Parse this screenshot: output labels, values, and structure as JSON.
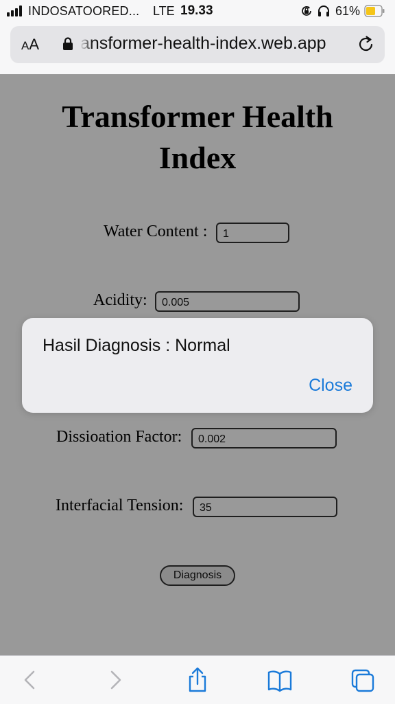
{
  "status_bar": {
    "carrier": "INDOSATOORED...",
    "network": "LTE",
    "time": "19.33",
    "battery_percent": "61%",
    "icons": [
      "signal-bars-icon",
      "orientation-lock-icon",
      "headphones-icon",
      "battery-icon"
    ]
  },
  "browser": {
    "reader_label_small": "A",
    "reader_label_big": "A",
    "url": "ansformer-health-index.web.app",
    "icons": [
      "padlock-icon",
      "reload-icon"
    ]
  },
  "page": {
    "title": "Transformer Health Index",
    "fields": [
      {
        "label": "Water Content :",
        "value": "1"
      },
      {
        "label": "Acidity:",
        "value": "0.005"
      },
      {
        "label": "Dissioation Factor:",
        "value": "0.002"
      },
      {
        "label": "Interfacial Tension:",
        "value": "35"
      }
    ],
    "button_label": "Diagnosis"
  },
  "alert": {
    "message": "Hasil Diagnosis : Normal",
    "close_label": "Close"
  },
  "toolbar": {
    "icons": [
      "back-icon",
      "forward-icon",
      "share-icon",
      "bookmarks-icon",
      "tabs-icon"
    ]
  },
  "colors": {
    "link_blue": "#1a7ad9",
    "battery_fill": "#f5c518",
    "dim_overlay": "rgba(0,0,0,0.40)"
  }
}
